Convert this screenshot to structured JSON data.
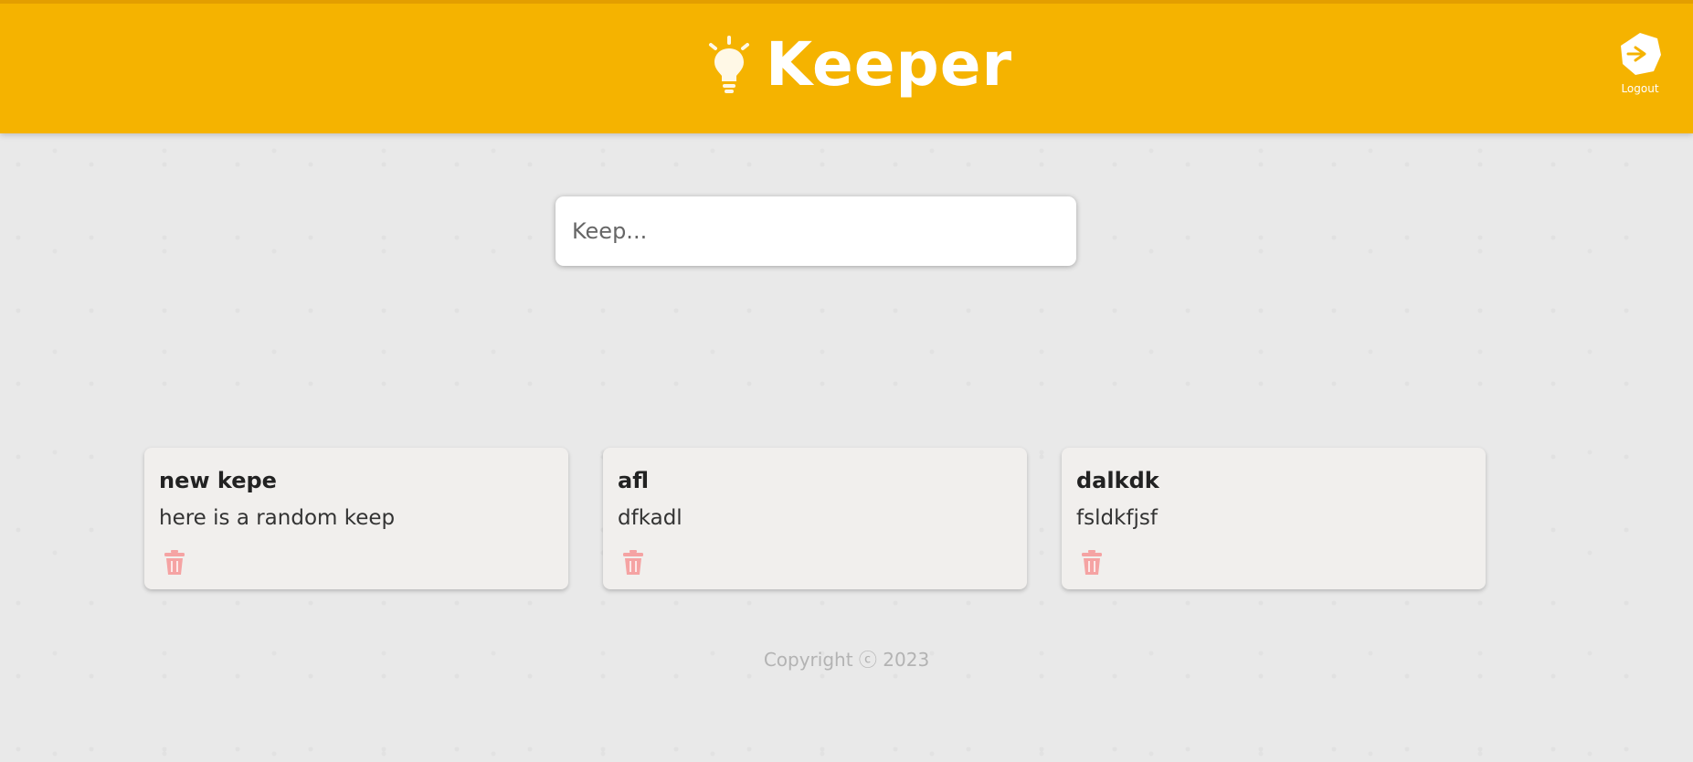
{
  "header": {
    "title": "Keeper",
    "logo_icon": "lightbulb-icon",
    "logout_icon": "logout-icon",
    "logout_label": "Logout",
    "colors": {
      "background": "#f5b300",
      "text": "#ffffff"
    }
  },
  "create_note": {
    "placeholder": "Keep...",
    "value": ""
  },
  "notes": [
    {
      "title": "new kepe",
      "content": "here is a random keep",
      "delete_icon": "trash-icon"
    },
    {
      "title": "afl",
      "content": "dfkadl",
      "delete_icon": "trash-icon"
    },
    {
      "title": "dalkdk",
      "content": "fsldkfjsf",
      "delete_icon": "trash-icon"
    }
  ],
  "footer": {
    "copyright": "Copyright ⓒ 2023"
  },
  "colors": {
    "accent": "#f5b300",
    "delete": "#f5a3a3",
    "note_bg": "#f1efed"
  }
}
